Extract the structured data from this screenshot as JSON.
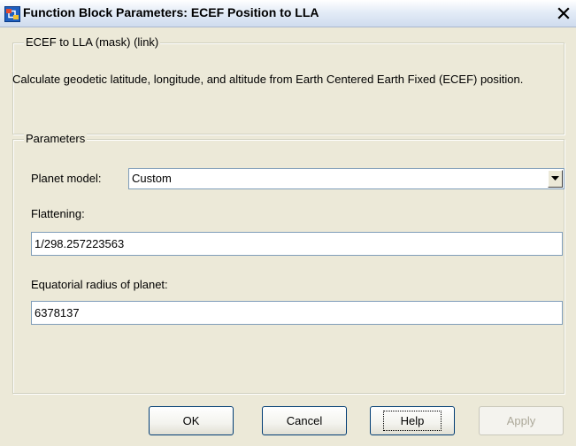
{
  "window": {
    "title": "Function Block Parameters: ECEF Position to LLA",
    "close_glyph": "✕"
  },
  "block": {
    "group_title": "ECEF to LLA (mask) (link)",
    "description": "Calculate geodetic latitude, longitude, and altitude from Earth Centered Earth Fixed (ECEF) position."
  },
  "parameters": {
    "group_title": "Parameters",
    "planet_model": {
      "label": "Planet model:",
      "value": "Custom"
    },
    "flattening": {
      "label": "Flattening:",
      "value": "1/298.257223563"
    },
    "equatorial_radius": {
      "label": "Equatorial radius of planet:",
      "value": "6378137"
    }
  },
  "buttons": {
    "ok": "OK",
    "cancel": "Cancel",
    "help": "Help",
    "apply": "Apply"
  },
  "colors": {
    "window_bg": "#ece9d8",
    "field_border": "#7f9db9",
    "disabled_text": "#aca899"
  },
  "icons": {
    "app": "simulink-block-icon",
    "close": "close-icon",
    "dropdown": "chevron-down-icon"
  }
}
